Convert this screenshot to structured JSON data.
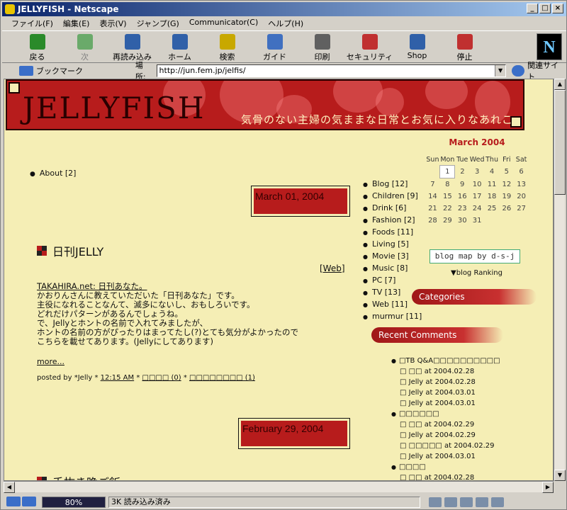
{
  "window": {
    "title": "JELLYFISH - Netscape"
  },
  "menu": [
    "ファイル(F)",
    "編集(E)",
    "表示(V)",
    "ジャンプ(G)",
    "Communicator(C)",
    "ヘルプ(H)"
  ],
  "toolbar": [
    {
      "label": "戻る",
      "icon": "back-arrow-icon",
      "color": "#2a8a2a"
    },
    {
      "label": "次",
      "icon": "forward-arrow-icon",
      "color": "#6aaa6a",
      "disabled": true
    },
    {
      "label": "再読み込み",
      "icon": "reload-icon",
      "color": "#3060a8"
    },
    {
      "label": "ホーム",
      "icon": "home-icon",
      "color": "#3060a8"
    },
    {
      "label": "検索",
      "icon": "search-icon",
      "color": "#c8a800"
    },
    {
      "label": "ガイド",
      "icon": "guide-icon",
      "color": "#4070c0"
    },
    {
      "label": "印刷",
      "icon": "print-icon",
      "color": "#606060"
    },
    {
      "label": "セキュリティ",
      "icon": "lock-icon",
      "color": "#c03030"
    },
    {
      "label": "Shop",
      "icon": "shop-icon",
      "color": "#3060a8"
    },
    {
      "label": "停止",
      "icon": "stop-icon",
      "color": "#c03030"
    }
  ],
  "location": {
    "bookmark_label": "ブックマーク",
    "label": "場所:",
    "url": "http://jun.fem.jp/jelfis/",
    "related": "関連サイト"
  },
  "status": {
    "progress": "80%",
    "message": "3K 読み込み済み"
  },
  "site": {
    "logo": "JELLYFISH",
    "tagline": "気骨のない主婦の気ままな日常とお気に入りなあれこれ",
    "about": "About [2]"
  },
  "posts": [
    {
      "date": "March 01, 2004",
      "title": "日刊JELLY",
      "category": "[Web]",
      "lines": [
        "TAKAHIRA.net: 日刊あなた。",
        "かおりんさんに教えていただいた「日刊あなた」です。",
        "主役になれることなんて、滅多にないし、おもしろいです。",
        "どれだけパターンがあるんでしょうね。",
        "で、Jellyとホントの名前で入れてみましたが、",
        "ホントの名前の方がぴったりはまってたし(?)とても気分がよかったので",
        "こちらを載せてあります。(Jellyにしてあります)"
      ],
      "more": "more...",
      "posted_prefix": "posted by *Jelly *",
      "time": "12:15 AM",
      "comments_link": "□□□□ (0)",
      "trackback_link": "□□□□□□□□ (1)"
    },
    {
      "date": "February 29, 2004",
      "title": "手抜き晩ご飯"
    }
  ],
  "categories": [
    "Blog [12]",
    "Children [9]",
    "Drink [6]",
    "Fashion [2]",
    "Foods [11]",
    "Living [5]",
    "Movie [3]",
    "Music [8]",
    "PC [7]",
    "TV [13]",
    "Web [11]",
    "murmur [11]"
  ],
  "calendar": {
    "title": "March 2004",
    "days": [
      "Sun",
      "Mon",
      "Tue",
      "Wed",
      "Thu",
      "Fri",
      "Sat"
    ],
    "weeks": [
      [
        "",
        "1",
        "2",
        "3",
        "4",
        "5",
        "6"
      ],
      [
        "7",
        "8",
        "9",
        "10",
        "11",
        "12",
        "13"
      ],
      [
        "14",
        "15",
        "16",
        "17",
        "18",
        "19",
        "20"
      ],
      [
        "21",
        "22",
        "23",
        "24",
        "25",
        "26",
        "27"
      ],
      [
        "28",
        "29",
        "30",
        "31",
        "",
        "",
        ""
      ]
    ],
    "today": "1"
  },
  "sidebar": {
    "blogmap": "blog map by d-s-j",
    "ranking": "▼blog Ranking",
    "categories_heading": "Categories",
    "recent_comments_heading": "Recent Comments"
  },
  "recent_comments": [
    {
      "title": "□TB Q&A□□□□□□□□□□",
      "items": [
        "□ □□ at 2004.02.28",
        "□ Jelly at 2004.02.28",
        "□ Jelly at 2004.03.01",
        "□ Jelly at 2004.03.01"
      ]
    },
    {
      "title": "□□□□□□",
      "items": [
        "□ □□ at 2004.02.29",
        "□ Jelly at 2004.02.29",
        "□ □□□□□ at 2004.02.29",
        "□ Jelly at 2004.03.01"
      ]
    },
    {
      "title": "□□□□",
      "items": [
        "□ □□ at 2004.02.28"
      ]
    }
  ]
}
